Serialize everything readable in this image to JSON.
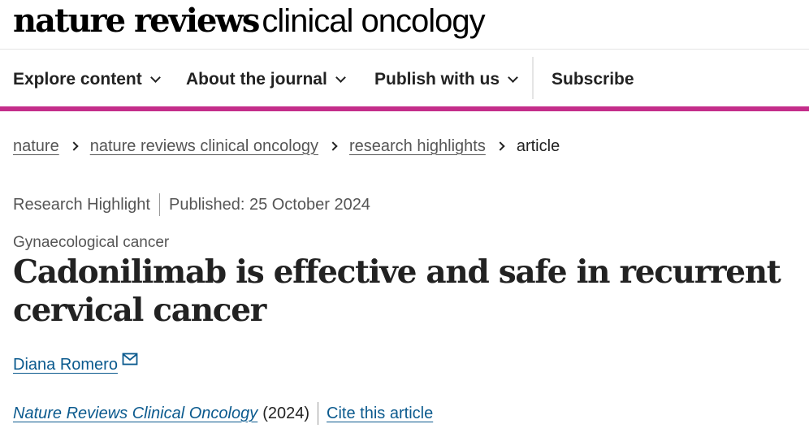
{
  "masthead": {
    "brand_bold": "nature reviews",
    "brand_light": "clinical oncology"
  },
  "nav": {
    "items": [
      {
        "label": "Explore content",
        "has_dropdown": true
      },
      {
        "label": "About the journal",
        "has_dropdown": true
      },
      {
        "label": "Publish with us",
        "has_dropdown": true
      },
      {
        "label": "Subscribe",
        "has_dropdown": false
      }
    ],
    "accent_color": "#c42d8a"
  },
  "breadcrumb": [
    {
      "label": "nature",
      "link": true
    },
    {
      "label": "nature reviews clinical oncology",
      "link": true
    },
    {
      "label": "research highlights",
      "link": true
    },
    {
      "label": "article",
      "link": false
    }
  ],
  "article": {
    "type": "Research Highlight",
    "published": "Published: 25 October 2024",
    "subject": "Gynaecological cancer",
    "title": "Cadonilimab is effective and safe in recurrent cervical cancer",
    "author": "Diana Romero",
    "author_icon": "envelope-icon",
    "journal": "Nature Reviews Clinical Oncology",
    "year": "(2024)",
    "cite_label": "Cite this article"
  },
  "colors": {
    "link": "#0b5a8e",
    "text": "#222222",
    "muted": "#555555"
  }
}
